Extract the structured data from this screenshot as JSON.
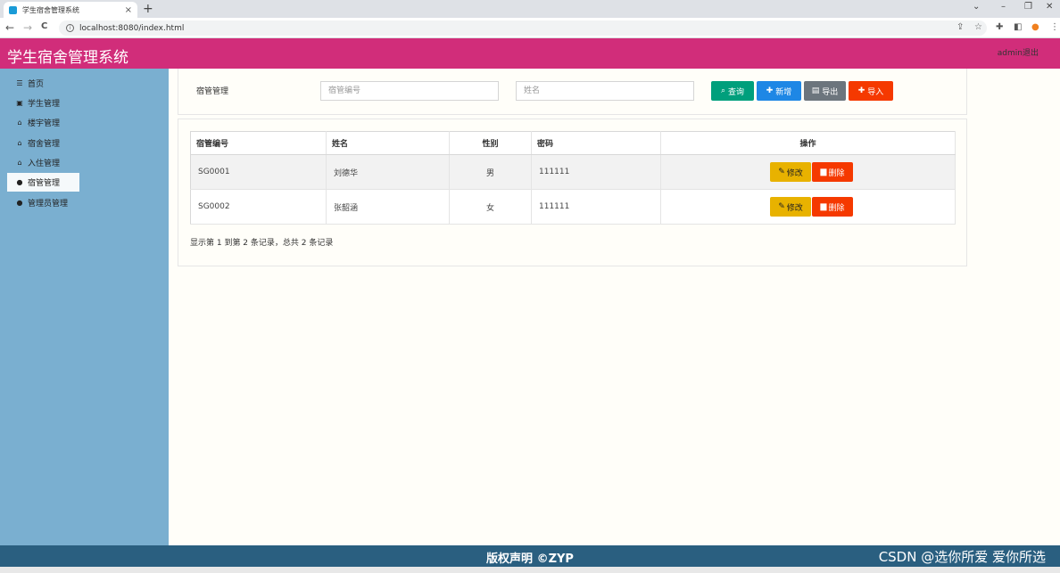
{
  "browser": {
    "tab_title": "学生宿舍管理系统",
    "tab_close": "×",
    "new_tab": "+",
    "url": "localhost:8080/index.html",
    "back": "←",
    "forward": "→",
    "reload": "C"
  },
  "header": {
    "title": "学生宿舍管理系统",
    "admin": "admin退出"
  },
  "sidebar": {
    "items": [
      {
        "label": "首页",
        "icon": "☰"
      },
      {
        "label": "学生管理",
        "icon": "▣"
      },
      {
        "label": "楼宇管理",
        "icon": "⌂"
      },
      {
        "label": "宿舍管理",
        "icon": "⌂"
      },
      {
        "label": "入住管理",
        "icon": "⌂"
      },
      {
        "label": "宿管管理",
        "icon": "●"
      },
      {
        "label": "管理员管理",
        "icon": "●"
      }
    ]
  },
  "search": {
    "label": "宿管管理",
    "code_placeholder": "宿管编号",
    "name_placeholder": "姓名",
    "query_label": "查询",
    "add_label": "新增",
    "export_label": "导出",
    "import_label": "导入"
  },
  "table": {
    "headers": [
      "宿管编号",
      "姓名",
      "性别",
      "密码",
      "操作"
    ],
    "rows": [
      {
        "code": "SG0001",
        "name": "刘德华",
        "gender": "男",
        "password": "111111"
      },
      {
        "code": "SG0002",
        "name": "张韶涵",
        "gender": "女",
        "password": "111111"
      }
    ],
    "edit_label": "修改",
    "delete_label": "删除",
    "records_text": "显示第 1 到第 2 条记录，总共 2 条记录"
  },
  "footer": {
    "text": "版权声明 ©ZYP",
    "watermark": "CSDN @选你所爱 爱你所选"
  }
}
